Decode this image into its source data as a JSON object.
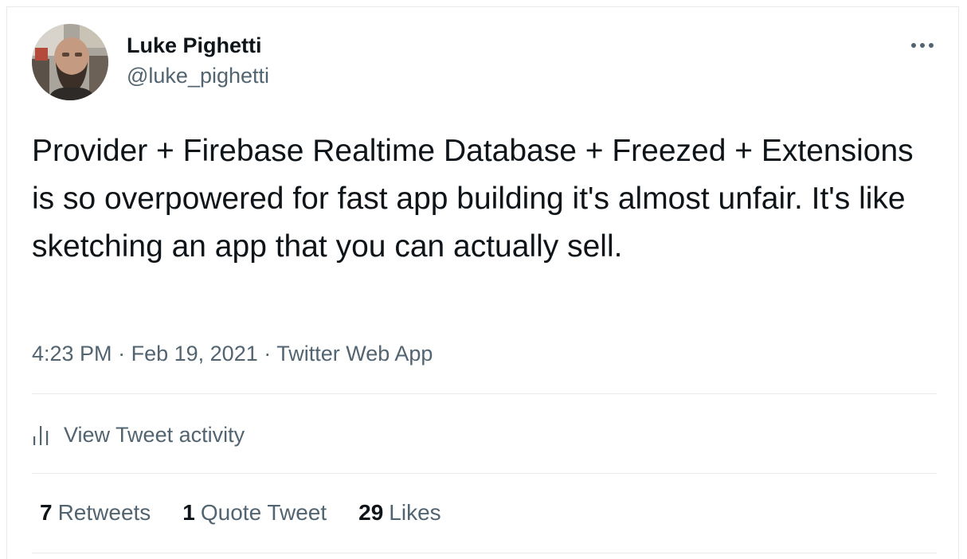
{
  "user": {
    "display_name": "Luke Pighetti",
    "handle": "@luke_pighetti"
  },
  "tweet": {
    "text": "Provider + Firebase Realtime Database + Freezed + Extensions is so overpowered for fast app building it's almost unfair. It's like sketching an app that you can actually sell.",
    "time": "4:23 PM",
    "separator": "·",
    "date": "Feb 19, 2021",
    "source": "Twitter Web App"
  },
  "activity": {
    "label": "View Tweet activity",
    "icon": "analytics-bars-icon"
  },
  "stats": {
    "retweets_count": "7",
    "retweets_label": "Retweets",
    "quotes_count": "1",
    "quotes_label": "Quote Tweet",
    "likes_count": "29",
    "likes_label": "Likes"
  },
  "menu": {
    "icon": "more-dots-icon"
  },
  "colors": {
    "text_primary": "#0f1419",
    "text_secondary": "#536471",
    "divider": "#e7e9ea"
  }
}
